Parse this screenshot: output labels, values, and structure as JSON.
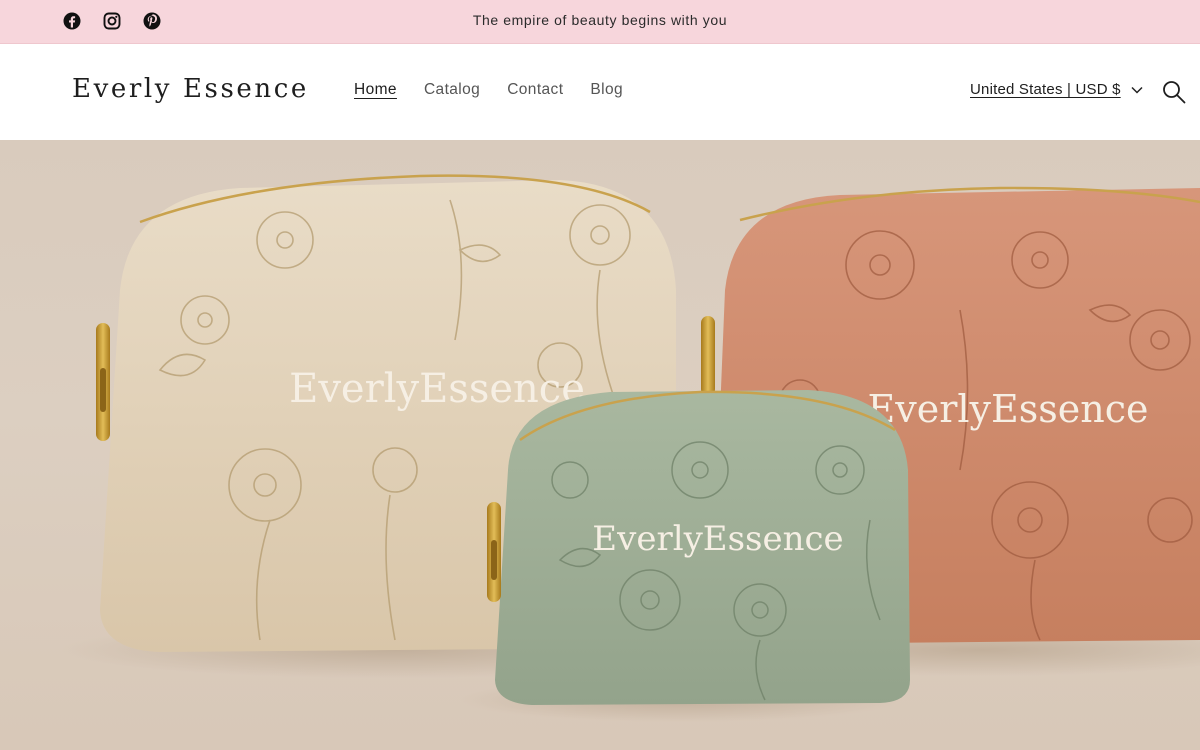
{
  "announcement": {
    "text": "The empire of beauty begins with you",
    "background": "#f7d6dc"
  },
  "social": [
    {
      "name": "facebook-icon"
    },
    {
      "name": "instagram-icon"
    },
    {
      "name": "pinterest-icon"
    }
  ],
  "header": {
    "logo": "Everly Essence",
    "nav": [
      {
        "label": "Home",
        "active": true
      },
      {
        "label": "Catalog"
      },
      {
        "label": "Contact"
      },
      {
        "label": "Blog"
      }
    ],
    "locale": "United States | USD $",
    "search_icon": "search-icon"
  },
  "hero": {
    "bags": [
      {
        "brand": "EverlyEssence",
        "color": "#e3d2b8"
      },
      {
        "brand": "EverlyEssence",
        "color": "#d08c6b"
      },
      {
        "brand": "EverlyEssence",
        "color": "#9fae95"
      }
    ]
  }
}
